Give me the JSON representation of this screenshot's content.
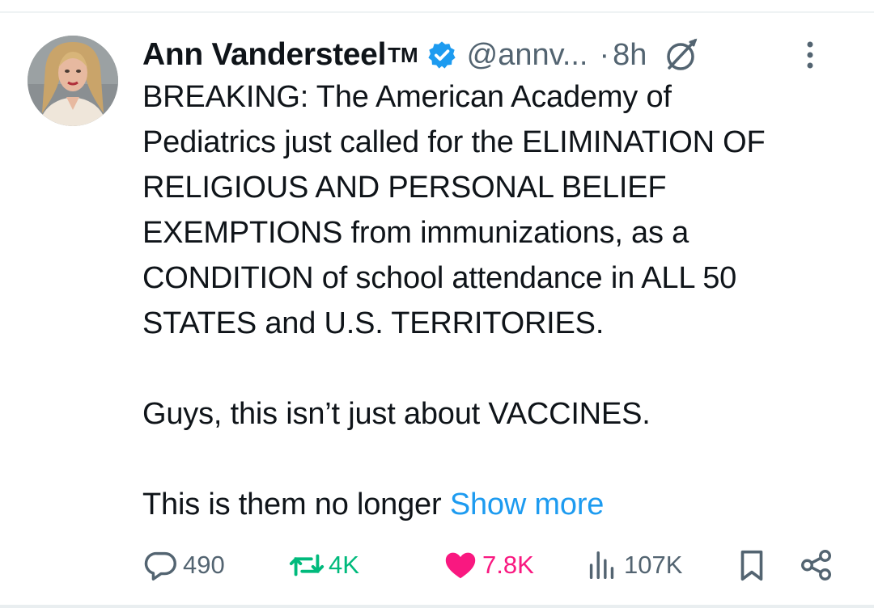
{
  "tweet": {
    "author": {
      "display_name": "Ann Vandersteel",
      "name_suffix": "TM",
      "handle": "@annv...",
      "verified": true,
      "avatar_icon": "profile-photo"
    },
    "separator": "·",
    "time": "8h",
    "text": "BREAKING: The American Academy of\nPediatrics just called for the ELIMINATION OF\nRELIGIOUS AND PERSONAL BELIEF\nEXEMPTIONS from immunizations, as a\nCONDITION of school attendance in ALL 50\nSTATES and U.S. TERRITORIES.\n\nGuys, this isn’t just about VACCINES.\n\nThis is them no longer ",
    "show_more_label": "Show more",
    "stats": {
      "replies": "490",
      "reposts": "4K",
      "likes": "7.8K",
      "views": "107K"
    }
  },
  "icons": {
    "verified": "verified-badge-icon",
    "grok": "grok-icon",
    "more": "more-options-icon",
    "reply": "reply-icon",
    "repost": "repost-icon",
    "like": "heart-icon",
    "views": "views-icon",
    "bookmark": "bookmark-icon",
    "share": "share-icon"
  },
  "colors": {
    "text": "#0f1419",
    "secondary": "#536471",
    "link": "#1d9bf0",
    "verified": "#1d9bf0",
    "repost_active": "#00ba7c",
    "like_active": "#f91880"
  }
}
